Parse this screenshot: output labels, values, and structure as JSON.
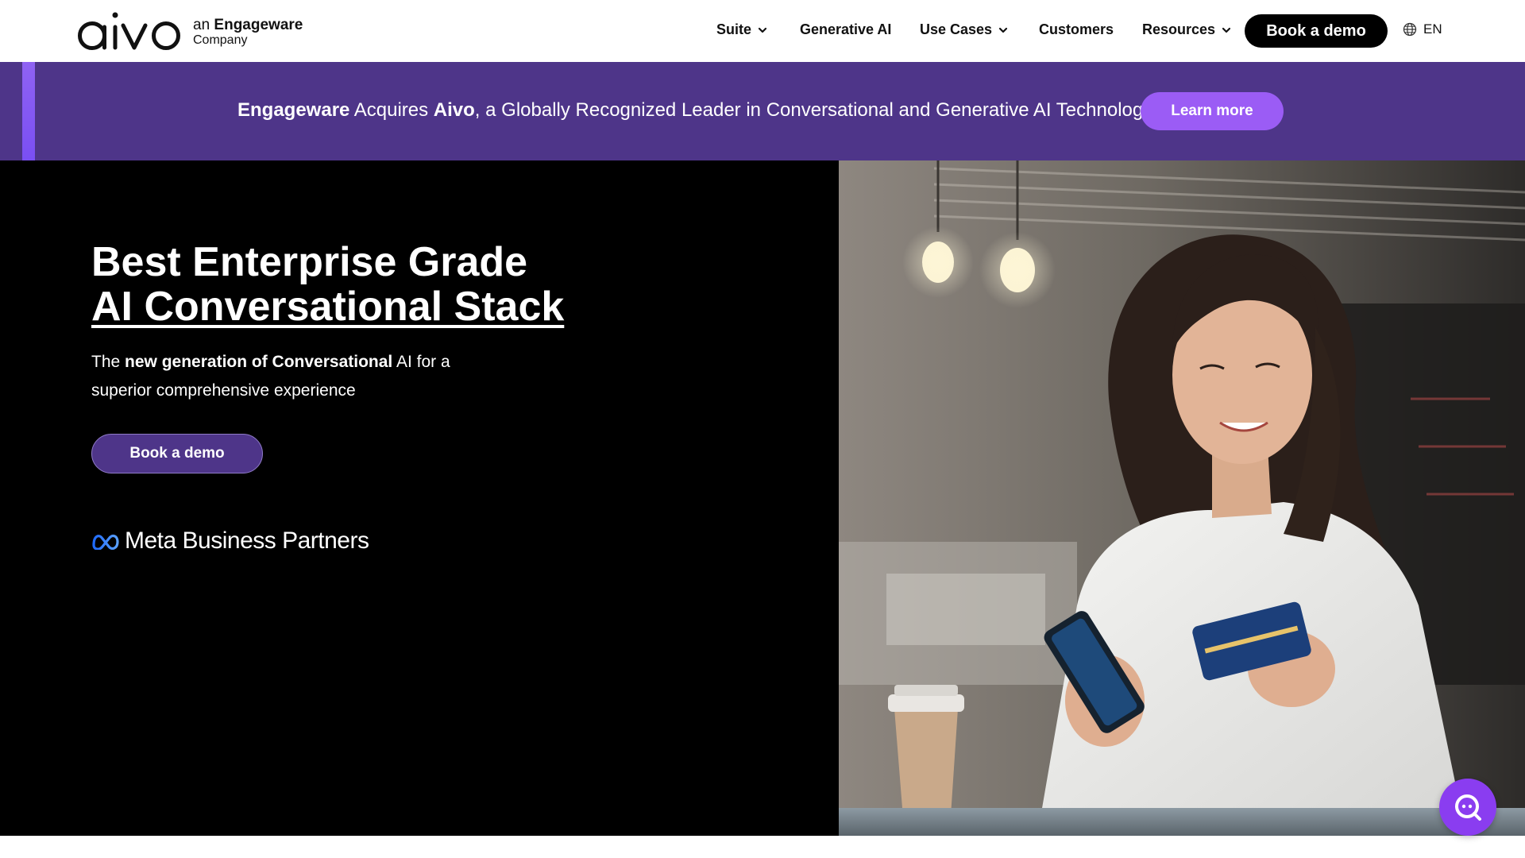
{
  "header": {
    "logo_text": "aivo",
    "logo_sub_prefix": "an",
    "logo_sub_brand": "Engageware",
    "logo_sub_line2": "Company",
    "nav": [
      {
        "label": "Suite",
        "has_dropdown": true
      },
      {
        "label": "Generative AI",
        "has_dropdown": false
      },
      {
        "label": "Use Cases",
        "has_dropdown": true
      },
      {
        "label": "Customers",
        "has_dropdown": false
      },
      {
        "label": "Resources",
        "has_dropdown": true
      }
    ],
    "cta_label": "Book a demo",
    "language": "EN"
  },
  "banner": {
    "brand1": "Engageware",
    "verb": " Acquires ",
    "brand2": "Aivo",
    "rest": ", a Globally Recognized Leader in Conversational and Generative AI Technology",
    "button_label": "Learn more",
    "background": "#4e3589",
    "button_color": "#9b5cf5"
  },
  "hero": {
    "title_line1": "Best Enterprise Grade",
    "title_line2": "AI Conversational Stack",
    "subtitle_pre": "The ",
    "subtitle_bold": "new generation of Conversational",
    "subtitle_post": " AI for a superior comprehensive experience",
    "cta_label": "Book a demo",
    "partner_label": "Meta Business Partners"
  },
  "icons": {
    "language": "globe-icon",
    "dropdown": "chevron-down-icon",
    "partner": "meta-infinity-icon",
    "chat": "chat-bubble-icon"
  }
}
